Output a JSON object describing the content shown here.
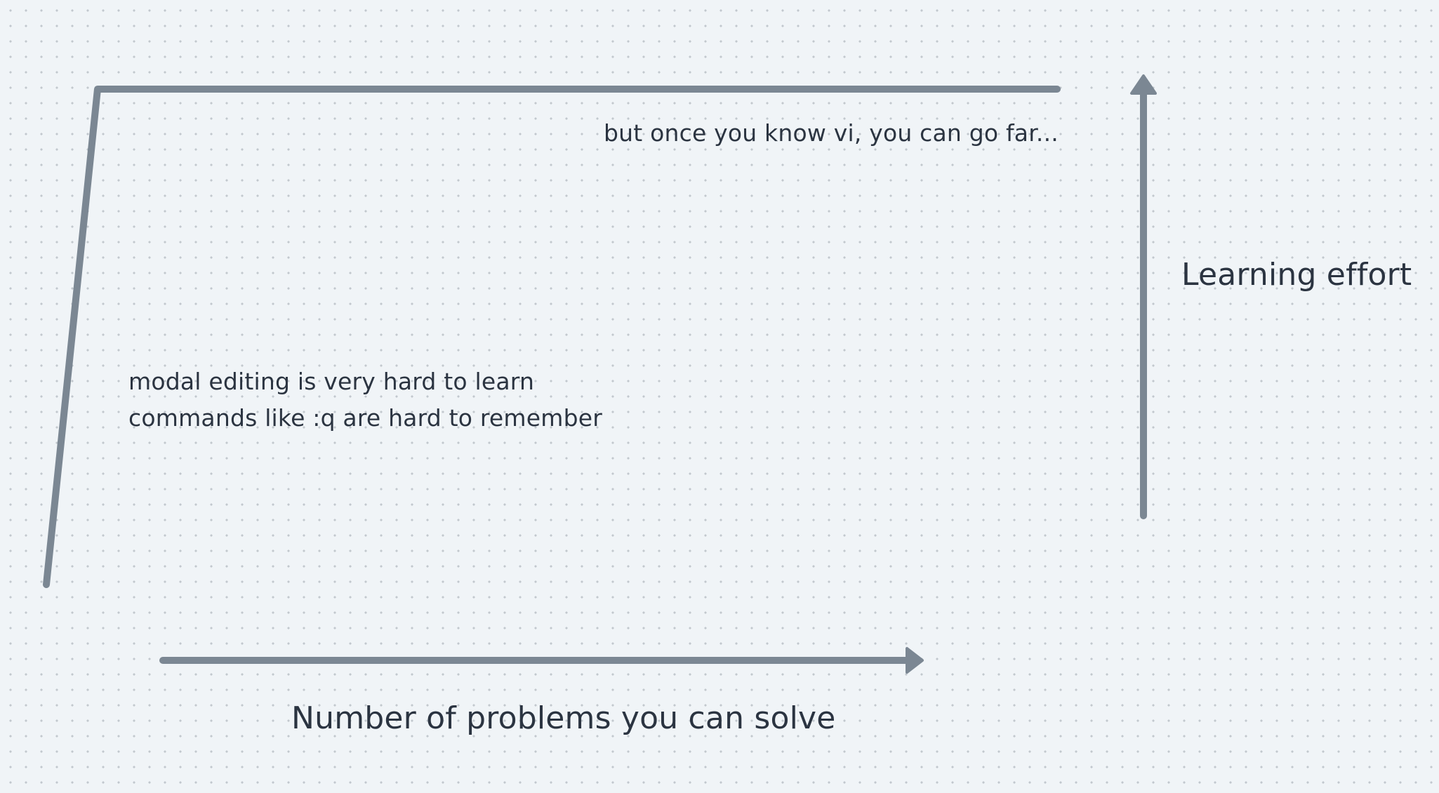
{
  "diagram": {
    "top_note": "but once you know vi, you can go far...",
    "left_note_lines": [
      "modal editing is very hard to learn",
      "commands like :q are hard to remember"
    ],
    "y_axis_label": "Learning effort",
    "x_axis_label": "Number of problems you can solve"
  },
  "colors": {
    "background": "#f0f4f7",
    "stroke": "#7b8793",
    "text": "#2b3441"
  }
}
